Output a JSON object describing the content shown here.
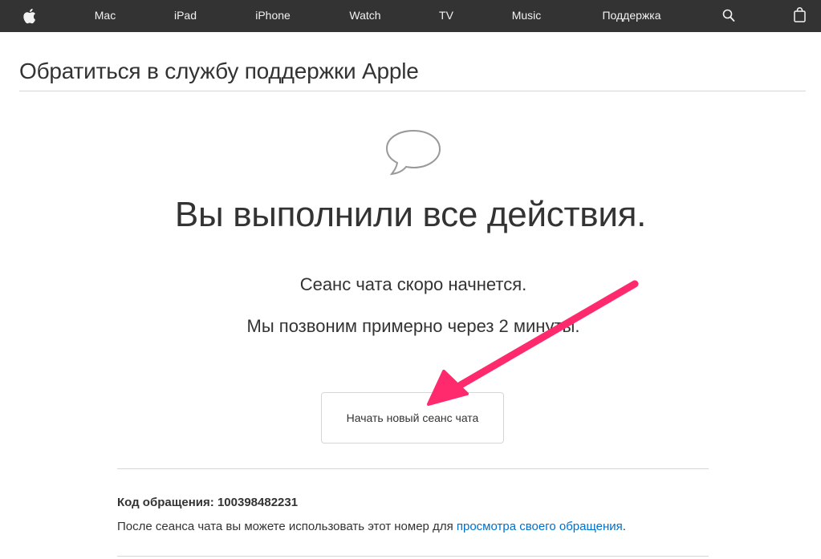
{
  "nav": {
    "items": [
      {
        "label": "Mac"
      },
      {
        "label": "iPad"
      },
      {
        "label": "iPhone"
      },
      {
        "label": "Watch"
      },
      {
        "label": "TV"
      },
      {
        "label": "Music"
      },
      {
        "label": "Поддержка"
      }
    ],
    "icons": [
      "apple-logo-icon",
      "search-icon",
      "shopping-bag-icon"
    ]
  },
  "page": {
    "title": "Обратиться в службу поддержки Apple"
  },
  "main": {
    "headline": "Вы выполнили все действия.",
    "line1": "Сеанс чата скоро начнется.",
    "line2": "Мы позвоним примерно через 2 минуты.",
    "button_label": "Начать новый сеанс чата",
    "case_label": "Код обращения:",
    "case_number": "100398482231",
    "note_text": "После сеанса чата вы можете использовать этот номер для ",
    "note_link": "просмотра своего обращения",
    "note_end": "."
  },
  "colors": {
    "nav_bg": "#333333",
    "link": "#0070c9",
    "annotation_arrow": "#ff2a6d"
  }
}
